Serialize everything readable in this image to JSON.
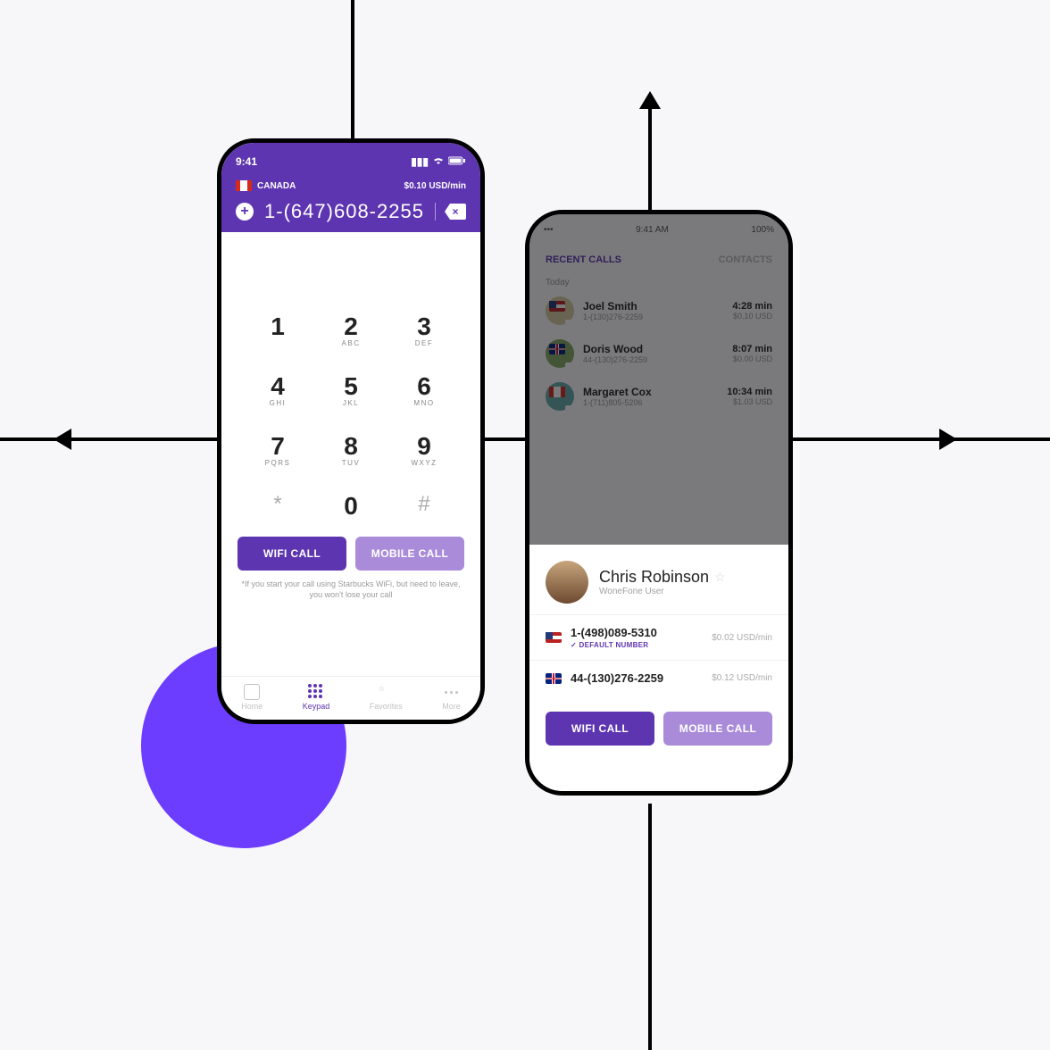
{
  "phone1": {
    "status_time": "9:41",
    "country_label": "CANADA",
    "rate_label": "$0.10 USD/min",
    "dialed_number": "1-(647)608-2255",
    "keys": [
      {
        "d": "1",
        "l": ""
      },
      {
        "d": "2",
        "l": "ABC"
      },
      {
        "d": "3",
        "l": "DEF"
      },
      {
        "d": "4",
        "l": "GHI"
      },
      {
        "d": "5",
        "l": "JKL"
      },
      {
        "d": "6",
        "l": "MNO"
      },
      {
        "d": "7",
        "l": "PQRS"
      },
      {
        "d": "8",
        "l": "TUV"
      },
      {
        "d": "9",
        "l": "WXYZ"
      },
      {
        "d": "*",
        "l": ""
      },
      {
        "d": "0",
        "l": ""
      },
      {
        "d": "#",
        "l": ""
      }
    ],
    "wifi_label": "WIFI CALL",
    "mobile_label": "MOBILE CALL",
    "disclaimer": "*If you start your call using Starbucks WiFi, but need to leave, you won't lose your call",
    "tabs": {
      "home": "Home",
      "keypad": "Keypad",
      "favorites": "Favorites",
      "more": "More"
    }
  },
  "phone2": {
    "status_time": "9:41 AM",
    "status_batt": "100%",
    "tabs": {
      "recent": "RECENT CALLS",
      "contacts": "CONTACTS"
    },
    "group_label": "Today",
    "calls": [
      {
        "name": "Joel Smith",
        "number": "1-(130)276-2259",
        "duration": "4:28 min",
        "cost": "$0.10 USD",
        "flag": "us",
        "av": "#d9cfa0"
      },
      {
        "name": "Doris Wood",
        "number": "44-(130)276-2259",
        "duration": "8:07 min",
        "cost": "$0.00 USD",
        "flag": "uk",
        "av": "#8a6"
      },
      {
        "name": "Margaret Cox",
        "number": "1-(711)805-5206",
        "duration": "10:34 min",
        "cost": "$1.03 USD",
        "flag": "ca",
        "av": "#6aa"
      }
    ],
    "sheet": {
      "name": "Chris Robinson",
      "subtitle": "WoneFone User",
      "numbers": [
        {
          "flag": "us",
          "value": "1-(498)089-5310",
          "rate": "$0.02 USD/min",
          "default_label": "DEFAULT NUMBER",
          "is_default": true
        },
        {
          "flag": "uk",
          "value": "44-(130)276-2259",
          "rate": "$0.12 USD/min",
          "is_default": false
        }
      ],
      "wifi_label": "WIFI CALL",
      "mobile_label": "MOBILE CALL"
    }
  }
}
